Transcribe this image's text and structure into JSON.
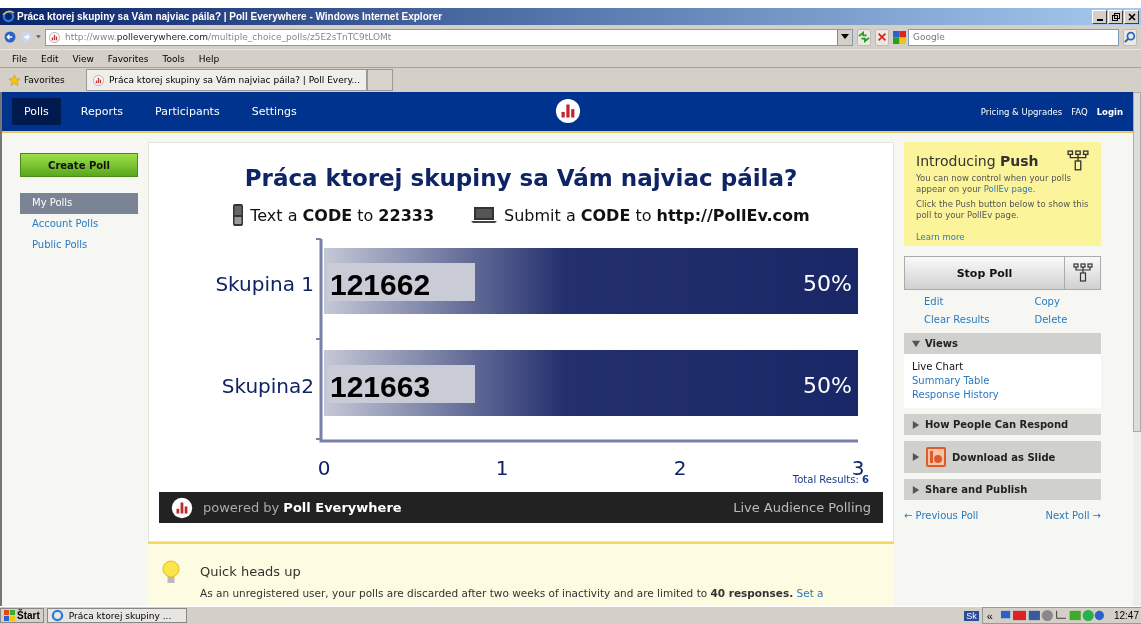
{
  "browser": {
    "title": "Práca ktorej skupiny sa Vám najviac páila? | Poll Everywhere - Windows Internet Explorer",
    "url_prefix": "http://www.",
    "url_domain": "polleverywhere.com",
    "url_path": "/multiple_choice_polls/z5E2sTnTC9tLOMt",
    "search_placeholder": "Google",
    "menu": [
      "File",
      "Edit",
      "View",
      "Favorites",
      "Tools",
      "Help"
    ],
    "favorites": "Favorites",
    "tabs": [
      {
        "label": "Práca ktorej skupiny sa Vám najviac páila? | Poll Every...",
        "selected": true
      }
    ]
  },
  "nav": {
    "items": [
      {
        "label": "Polls",
        "selected": true
      },
      {
        "label": "Reports",
        "selected": false
      },
      {
        "label": "Participants",
        "selected": false
      },
      {
        "label": "Settings",
        "selected": false
      }
    ],
    "links": [
      "Pricing & Upgrades",
      "FAQ",
      "Login"
    ]
  },
  "sidebar": {
    "create_button": "Create Poll",
    "items": [
      {
        "label": "My Polls",
        "selected": true
      },
      {
        "label": "Account Polls",
        "selected": false
      },
      {
        "label": "Public Polls",
        "selected": false
      }
    ]
  },
  "poll": {
    "title": "Práca ktorej skupiny sa Vám najviac páila?",
    "instructions": [
      {
        "kind": "phone",
        "text": "Text a **CODE** to **22333**"
      },
      {
        "kind": "web",
        "text": "Submit a **CODE** to **http://PollEv.com**"
      }
    ],
    "chart_data": {
      "type": "bar",
      "orientation": "horizontal",
      "categories": [
        "Skupina 1",
        "Skupina2"
      ],
      "values": [
        3,
        3
      ],
      "xlim": [
        0,
        3
      ],
      "xticks": [
        0,
        1,
        2,
        3
      ]
    },
    "codes": [
      "121662",
      "121663"
    ],
    "percentages": [
      "50%",
      "50%"
    ],
    "total": "Total Results: **6**",
    "footer_brand": "powered by **Poll Everywhere**",
    "footer_tagline": "Live Audience Polling"
  },
  "notice": {
    "title": "Quick heads up",
    "text": "As an unregistered user, your polls are discarded after two weeks of inactivity and are limited to **40 responses.**",
    "link": "Set a"
  },
  "push": {
    "title": "Introducing **Push**",
    "text1": "You can now control when your polls appear on your",
    "link1": "PollEv page",
    "text1_end": ".",
    "text2": "Click the Push button below to show this poll to your PollEv page.",
    "learn_more": "Learn more"
  },
  "controls": {
    "stop_button": "Stop Poll",
    "actions": [
      "Edit",
      "Copy",
      "Clear Results",
      "Delete"
    ]
  },
  "sections": [
    {
      "kind": "plain",
      "title": "Views",
      "expanded": true,
      "items": [
        {
          "label": "Live Chart",
          "selected": true
        },
        {
          "label": "Summary Table",
          "selected": false
        },
        {
          "label": "Response History",
          "selected": false
        }
      ]
    },
    {
      "kind": "plain",
      "title": "How People Can Respond",
      "expanded": false
    },
    {
      "kind": "slide",
      "title": "Download as Slide",
      "expanded": false
    },
    {
      "kind": "plain",
      "title": "Share and Publish",
      "expanded": false
    }
  ],
  "pager": {
    "previous": "← Previous Poll",
    "next": "Next Poll →"
  },
  "taskbar": {
    "start": "Štart",
    "task": "Práca ktorej skupiny ...",
    "language": "Sk",
    "chevron": "«",
    "clock": "12:47"
  }
}
